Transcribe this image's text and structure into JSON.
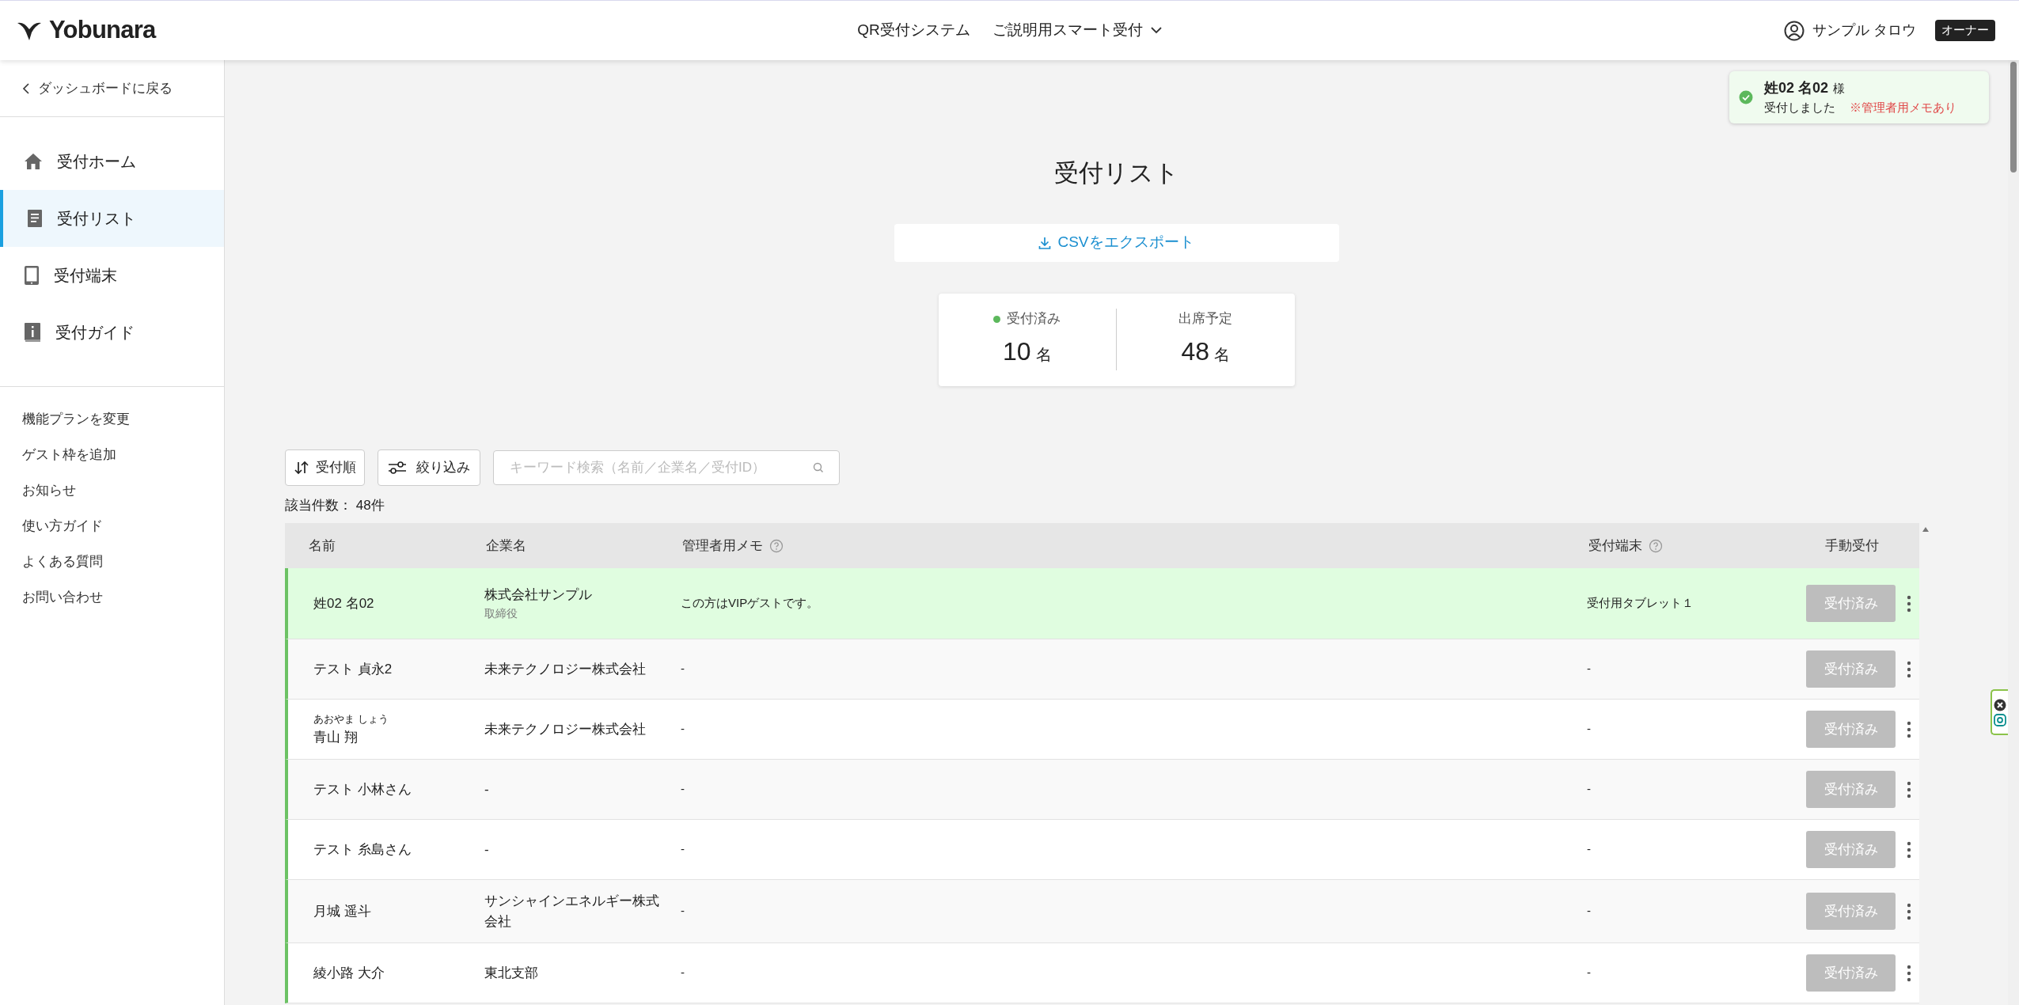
{
  "header": {
    "logo": "Yobunara",
    "system": "QR受付システム",
    "event": "ご説明用スマート受付",
    "user": "サンプル タロウ",
    "role": "オーナー"
  },
  "sidebar": {
    "back": "ダッシュボードに戻る",
    "items": [
      {
        "label": "受付ホーム",
        "kind": "home",
        "selected": false
      },
      {
        "label": "受付リスト",
        "kind": "list",
        "selected": true
      },
      {
        "label": "受付端末",
        "kind": "tablet",
        "selected": false
      },
      {
        "label": "受付ガイド",
        "kind": "guide",
        "selected": false
      }
    ],
    "links": [
      "機能プランを変更",
      "ゲスト枠を追加",
      "お知らせ",
      "使い方ガイド",
      "よくある質問",
      "お問い合わせ"
    ]
  },
  "toast": {
    "name": "姓02 名02",
    "suffix": "様",
    "message": "受付しました",
    "note": "※管理者用メモあり"
  },
  "page": {
    "title": "受付リスト",
    "export": "CSVをエクスポート"
  },
  "stats": [
    {
      "label": "受付済み",
      "value": "10",
      "unit": "名",
      "dot": true
    },
    {
      "label": "出席予定",
      "value": "48",
      "unit": "名",
      "dot": false
    }
  ],
  "toolbar": {
    "sort": "受付順",
    "filter": "絞り込み",
    "search_placeholder": "キーワード検索（名前／企業名／受付ID）"
  },
  "count": "該当件数： 48件",
  "table": {
    "columns": [
      {
        "label": "名前",
        "help": false
      },
      {
        "label": "企業名",
        "help": false
      },
      {
        "label": "管理者用メモ",
        "help": true
      },
      {
        "label": "受付端末",
        "help": true
      },
      {
        "label": "手動受付",
        "help": false
      }
    ],
    "rows": [
      {
        "kana": null,
        "name": "姓02 名02",
        "company": "株式会社サンプル",
        "position": "取締役",
        "memo": "この方はVIPゲストです。",
        "terminal": "受付用タブレット１",
        "action": "受付済み",
        "highlighted": true,
        "checked_in": true
      },
      {
        "name": "テスト 貞永2",
        "company": "未来テクノロジー株式会社",
        "memo": "-",
        "terminal": "-",
        "action": "受付済み",
        "highlighted": false,
        "checked_in": true
      },
      {
        "kana": "あおやま しょう",
        "name": "青山 翔",
        "company": "未来テクノロジー株式会社",
        "memo": "-",
        "terminal": "-",
        "action": "受付済み",
        "highlighted": false,
        "checked_in": true
      },
      {
        "name": "テスト 小林さん",
        "company": "-",
        "memo": "-",
        "terminal": "-",
        "action": "受付済み",
        "highlighted": false,
        "checked_in": true
      },
      {
        "name": "テスト 糸島さん",
        "company": "-",
        "memo": "-",
        "terminal": "-",
        "action": "受付済み",
        "highlighted": false,
        "checked_in": true
      },
      {
        "name": "月城 遥斗",
        "company": "サンシャインエネルギー株式会社",
        "memo": "-",
        "terminal": "-",
        "action": "受付済み",
        "highlighted": false,
        "checked_in": true
      },
      {
        "name": "綾小路 大介",
        "company": "東北支部",
        "memo": "-",
        "terminal": "-",
        "action": "受付済み",
        "highlighted": false,
        "checked_in": true
      }
    ]
  }
}
